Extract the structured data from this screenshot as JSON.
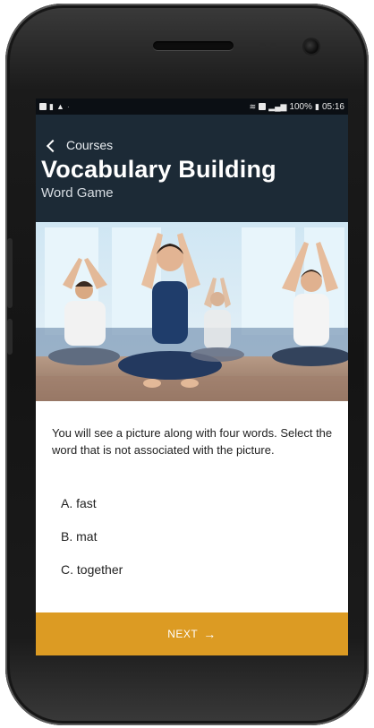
{
  "status_bar": {
    "battery": "100%",
    "time": "05:16"
  },
  "header": {
    "back_label": "Courses",
    "title": "Vocabulary Building",
    "subtitle": "Word Game"
  },
  "hero_image": {
    "description_icon": "yoga-class-photo"
  },
  "instructions": "You will see a picture along with four words. Select the word that is not associated with the picture.",
  "options": [
    {
      "label": "A. fast"
    },
    {
      "label": "B. mat"
    },
    {
      "label": "C. together"
    }
  ],
  "footer": {
    "next_label": "NEXT",
    "next_arrow": "→"
  },
  "colors": {
    "header_bg": "#1c2a36",
    "accent": "#dc9b23",
    "status_bar_bg": "#0b0f14"
  }
}
